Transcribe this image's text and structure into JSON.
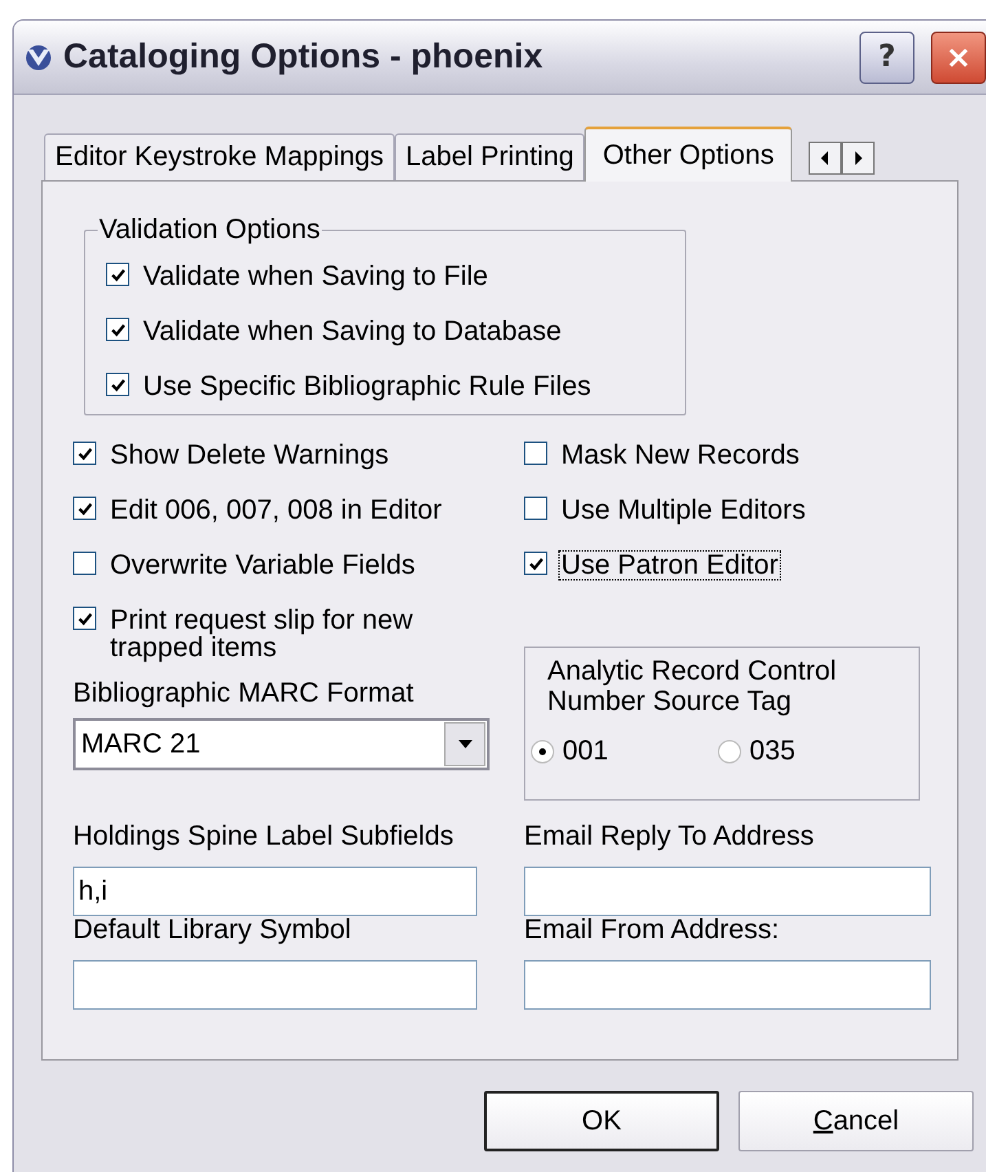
{
  "window": {
    "title": "Cataloging Options - phoenix",
    "help_button": "?"
  },
  "tabs": [
    {
      "label": "Editor Keystroke Mappings",
      "selected": false
    },
    {
      "label": "Label Printing",
      "selected": false
    },
    {
      "label": "Other Options",
      "selected": true
    }
  ],
  "validation_group": {
    "title": "Validation Options",
    "options": [
      {
        "label": "Validate when Saving to File",
        "checked": true
      },
      {
        "label": "Validate when Saving to Database",
        "checked": true
      },
      {
        "label": "Use Specific Bibliographic Rule Files",
        "checked": true
      }
    ]
  },
  "left_options": [
    {
      "label": "Show Delete Warnings",
      "checked": true,
      "focused": false
    },
    {
      "label": "Edit 006, 007, 008 in Editor",
      "checked": true,
      "focused": false
    },
    {
      "label": "Overwrite Variable Fields",
      "checked": false,
      "focused": false
    },
    {
      "label": "Print request slip for new trapped items",
      "checked": true,
      "focused": false
    }
  ],
  "right_options": [
    {
      "label": "Mask New Records",
      "checked": false,
      "focused": false
    },
    {
      "label": "Use Multiple Editors",
      "checked": false,
      "focused": false
    },
    {
      "label": "Use Patron Editor",
      "checked": true,
      "focused": true
    }
  ],
  "marc_format": {
    "label": "Bibliographic MARC Format",
    "value": "MARC 21"
  },
  "analytic_group": {
    "title": "Analytic Record Control Number Source Tag",
    "options": [
      {
        "label": "001",
        "selected": true
      },
      {
        "label": "035",
        "selected": false
      }
    ]
  },
  "fields": [
    {
      "label": "Holdings Spine Label Subfields",
      "value": "h,i"
    },
    {
      "label": "Email Reply To Address"
    },
    {
      "label": "Default Library Symbol"
    },
    {
      "label": "Email From Address:"
    }
  ],
  "buttons": [
    {
      "label": "OK",
      "default": true
    },
    {
      "label": "Cancel",
      "default": false,
      "first_letter_underlined": true
    }
  ]
}
